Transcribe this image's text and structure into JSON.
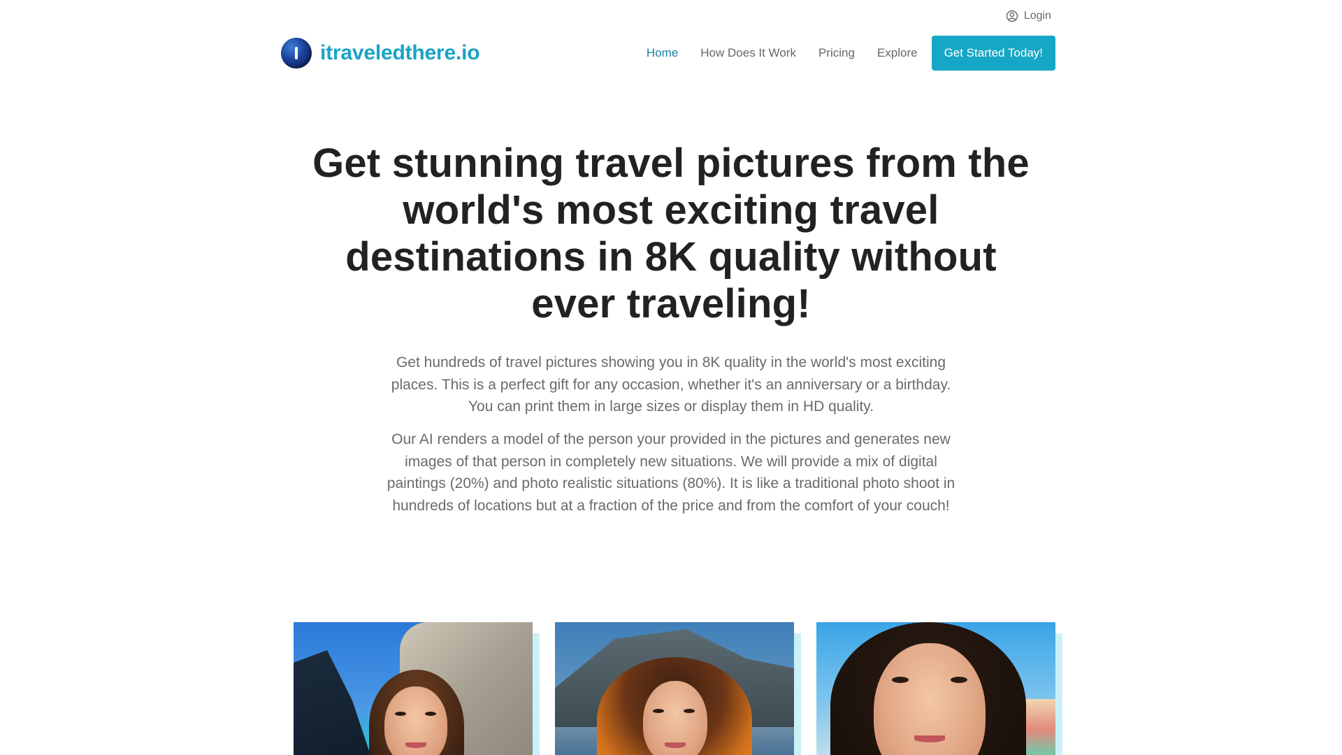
{
  "topbar": {
    "login_label": "Login",
    "login_icon": "user-circle-icon"
  },
  "brand": {
    "name": "itraveledthere.io",
    "logo_icon": "globe-logo-icon",
    "color": "#1aa3c4"
  },
  "nav": {
    "items": [
      {
        "label": "Home",
        "active": true
      },
      {
        "label": "How Does It Work",
        "active": false
      },
      {
        "label": "Pricing",
        "active": false
      },
      {
        "label": "Explore",
        "active": false
      }
    ],
    "cta_label": "Get Started Today!",
    "cta_color": "#17a7c6"
  },
  "hero": {
    "title": "Get stunning travel pictures from the world's most exciting travel destinations in 8K quality without ever traveling!",
    "paragraph_1": "Get hundreds of travel pictures showing you in 8K quality in the world's most exciting places. This is a perfect gift for any occasion, whether it's an anniversary or a birthday. You can print them in large sizes or display them in HD quality.",
    "paragraph_2": "Our AI renders a model of the person your provided in the pictures and generates new images of that person in completely new situations. We will provide a mix of digital paintings (20%) and photo realistic situations (80%). It is like a traditional photo shoot in hundreds of locations but at a fraction of the price and from the comfort of your couch!"
  },
  "gallery": {
    "images": [
      {
        "description_icon": "portrait-photo-icon"
      },
      {
        "description_icon": "portrait-photo-icon"
      },
      {
        "description_icon": "portrait-photo-icon"
      }
    ],
    "accent_color": "#c9f1f7"
  }
}
